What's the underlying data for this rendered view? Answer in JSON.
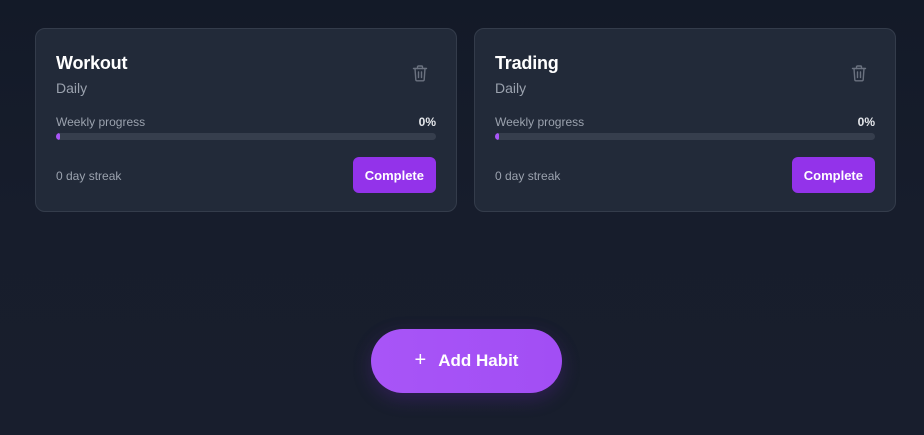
{
  "habits": [
    {
      "name": "Workout",
      "frequency": "Daily",
      "progress_label": "Weekly progress",
      "progress_percent": "0%",
      "progress_value": 0,
      "streak": "0 day streak",
      "complete_label": "Complete"
    },
    {
      "name": "Trading",
      "frequency": "Daily",
      "progress_label": "Weekly progress",
      "progress_percent": "0%",
      "progress_value": 0,
      "streak": "0 day streak",
      "complete_label": "Complete"
    }
  ],
  "add_habit": {
    "icon": "+",
    "label": "Add Habit"
  },
  "icons": {
    "delete": "trash-icon",
    "add": "plus-icon"
  },
  "colors": {
    "accent": "#9333ea",
    "accent_light": "#a855f7",
    "card_bg": "#222a39",
    "page_bg": "#171d2c"
  }
}
